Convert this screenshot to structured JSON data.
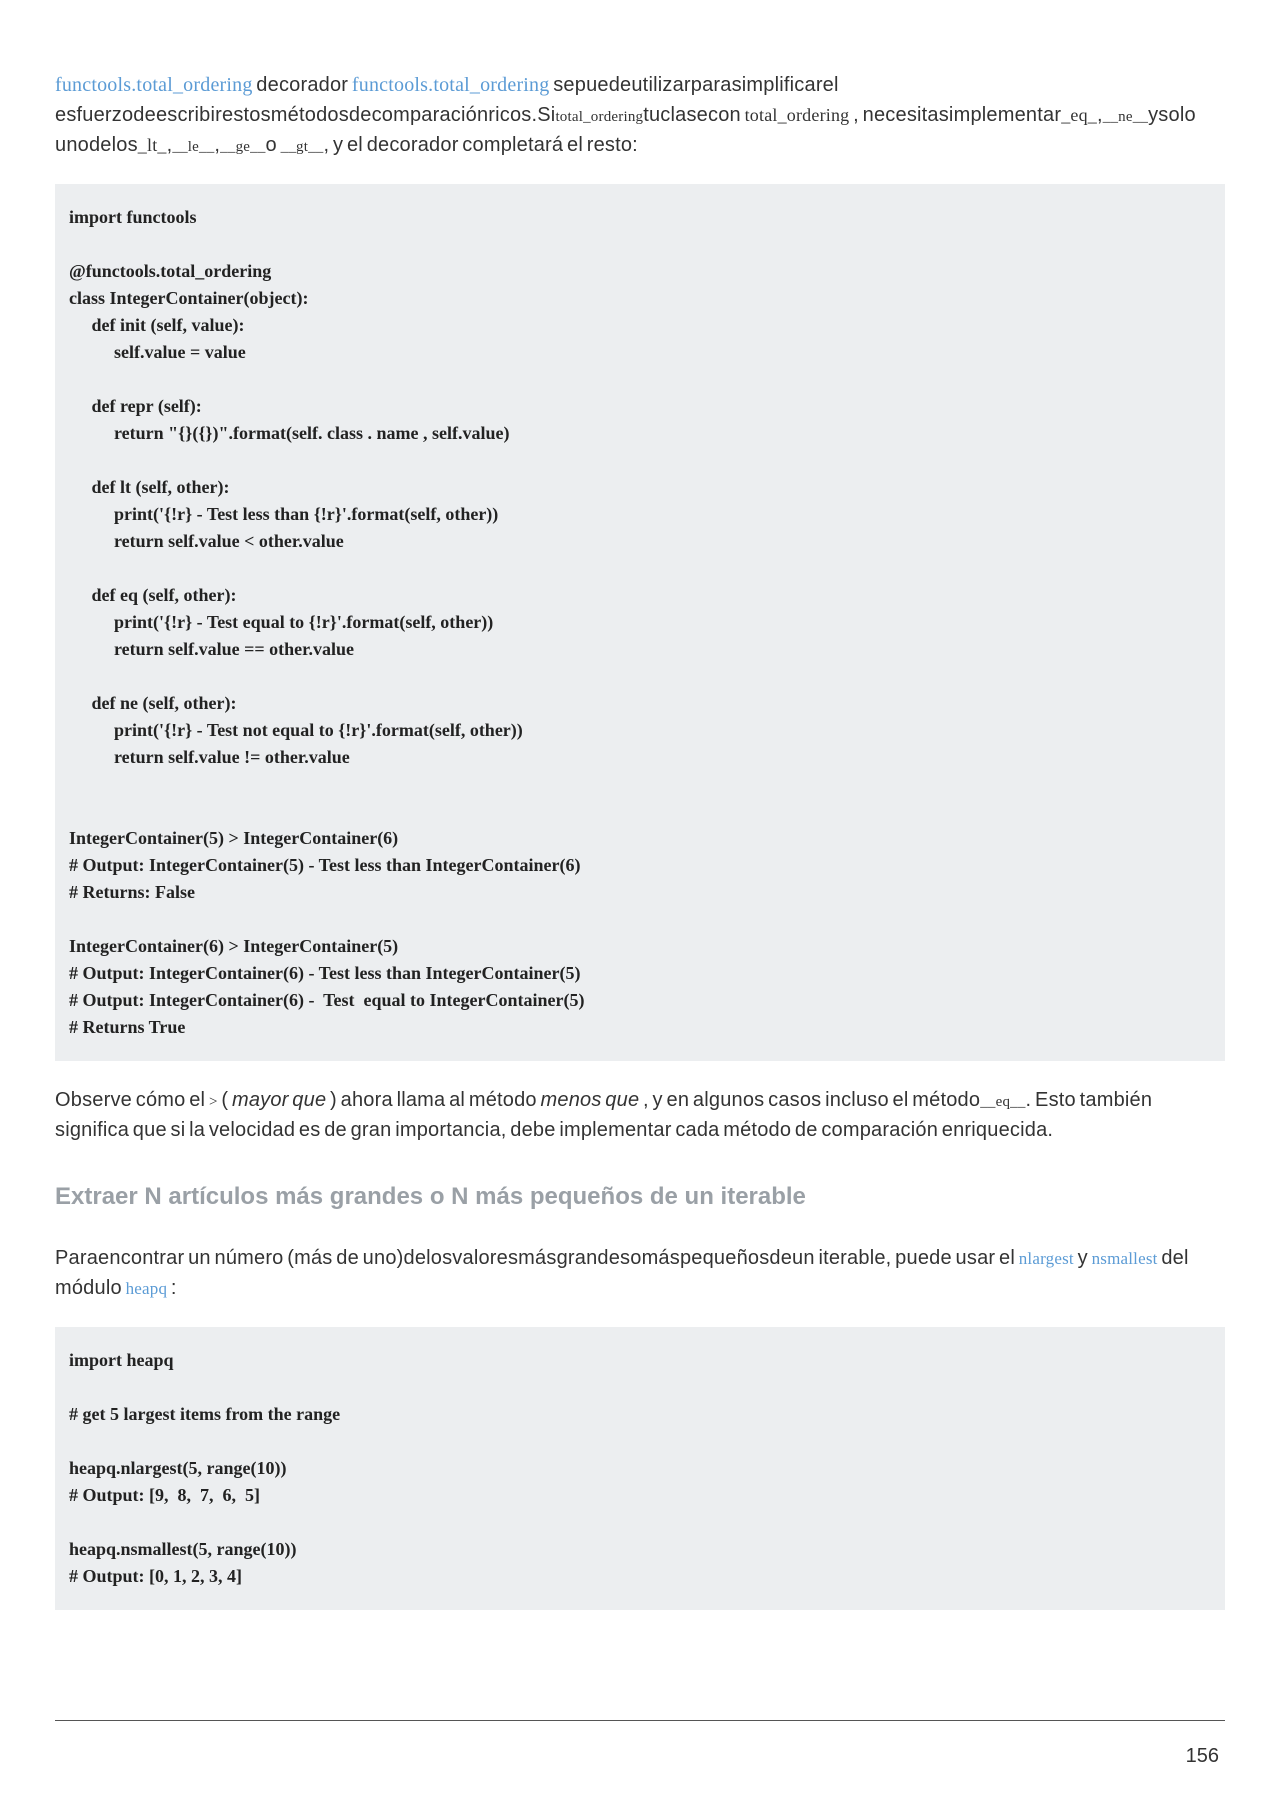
{
  "p1": {
    "link1": "functools.total_ordering",
    "t1": " decorador ",
    "link2": "functools.total_ordering",
    "t2": " sepuedeutilizarparasimplificarel esfuerzodeescribirestosmétodosdecomparaciónricos.Si",
    "m1": "total_ordering",
    "t3": "tuclasecon ",
    "m2": "total_ordering",
    "t4": " , necesitasimplementar",
    "m3": "_eq_",
    "t5": ",",
    "m3b": "__ne__",
    "t6": "ysolo unodelos",
    "m4": "_lt_",
    "t7": ",",
    "m5": "__le__",
    "t8": ",",
    "m6": "__ge__",
    "t9": "o ",
    "m7": "__gt__",
    "t10": ", y el decorador completará el resto:"
  },
  "code1": "import functools\n\n@functools.total_ordering\nclass IntegerContainer(object):\n     def init (self, value):\n          self.value = value\n\n     def repr (self):\n          return \"{}({})\".format(self. class . name , self.value)\n\n     def lt (self, other):\n          print('{!r} - Test less than {!r}'.format(self, other))\n          return self.value < other.value\n\n     def eq (self, other):\n          print('{!r} - Test equal to {!r}'.format(self, other))\n          return self.value == other.value\n\n     def ne (self, other):\n          print('{!r} - Test not equal to {!r}'.format(self, other))\n          return self.value != other.value\n\n\nIntegerContainer(5) > IntegerContainer(6)\n# Output: IntegerContainer(5) - Test less than IntegerContainer(6)\n# Returns: False\n\nIntegerContainer(6) > IntegerContainer(5)\n# Output: IntegerContainer(6) - Test less than IntegerContainer(5)\n# Output: IntegerContainer(6) -  Test  equal to IntegerContainer(5)\n# Returns True",
  "p2": {
    "t1": "Observe cómo el ",
    "sym": ">",
    "t2": " ( ",
    "it1": "mayor que",
    "t3": " ) ahora llama al método ",
    "it2": "menos que",
    "t4": " , y en algunos casos incluso el método",
    "m1": "__eq__",
    "t5": ". Esto también significa que si la velocidad es de gran importancia, debe implementar cada método de comparación enriquecida."
  },
  "heading": "Extraer N artículos más grandes o N más pequeños de un iterable",
  "p3": {
    "t1": "Paraencontrar un número (más de uno)delosvaloresmásgrandesomáspequeñosdeun iterable, puede usar el ",
    "link1": "nlargest",
    "t2": " y ",
    "link2": "nsmallest",
    "t3": " del módulo ",
    "link3": "heapq",
    "t4": " :"
  },
  "code2": "import heapq\n\n# get 5 largest items from the range\n\nheapq.nlargest(5, range(10))\n# Output: [9,  8,  7,  6,  5]\n\nheapq.nsmallest(5, range(10))\n# Output: [0, 1, 2, 3, 4]",
  "pagenum": "156"
}
